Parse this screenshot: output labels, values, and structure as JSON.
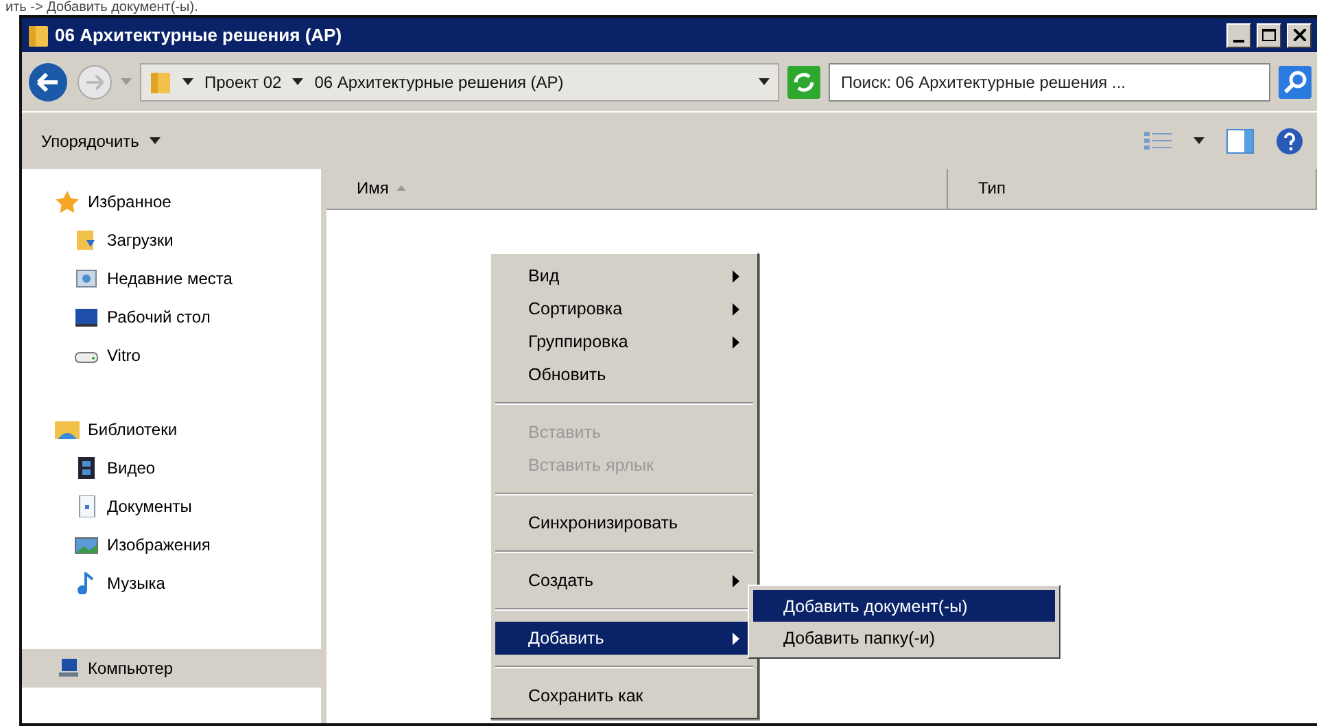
{
  "caption": "ить -> Добавить документ(-ы).",
  "window": {
    "title": "06 Архитектурные решения (АР)"
  },
  "address_bar": {
    "crumbs": [
      "Проект 02",
      "06 Архитектурные решения (АР)"
    ]
  },
  "search": {
    "placeholder": "Поиск: 06 Архитектурные решения ..."
  },
  "toolbar": {
    "organize": "Упорядочить"
  },
  "sidebar": {
    "groups": [
      {
        "label": "Избранное",
        "selected": false,
        "children": [
          {
            "label": "Загрузки",
            "selected": false
          },
          {
            "label": "Недавние места",
            "selected": false
          },
          {
            "label": "Рабочий стол",
            "selected": false
          },
          {
            "label": "Vitro",
            "selected": false
          }
        ]
      },
      {
        "label": "Библиотеки",
        "selected": false,
        "children": [
          {
            "label": "Видео",
            "selected": false
          },
          {
            "label": "Документы",
            "selected": false
          },
          {
            "label": "Изображения",
            "selected": false
          },
          {
            "label": "Музыка",
            "selected": false
          }
        ]
      },
      {
        "label": "Компьютер",
        "selected": true
      }
    ]
  },
  "table": {
    "columns": [
      {
        "label": "Имя",
        "sorted": true
      },
      {
        "label": "Тип",
        "sorted": false
      }
    ]
  },
  "context_menu": {
    "items": [
      {
        "kind": "item",
        "label": "Вид",
        "submenu": true,
        "disabled": false,
        "selected": false
      },
      {
        "kind": "item",
        "label": "Сортировка",
        "submenu": true,
        "disabled": false,
        "selected": false
      },
      {
        "kind": "item",
        "label": "Группировка",
        "submenu": true,
        "disabled": false,
        "selected": false
      },
      {
        "kind": "item",
        "label": "Обновить",
        "submenu": false,
        "disabled": false,
        "selected": false
      },
      {
        "kind": "separator"
      },
      {
        "kind": "item",
        "label": "Вставить",
        "submenu": false,
        "disabled": true,
        "selected": false
      },
      {
        "kind": "item",
        "label": "Вставить ярлык",
        "submenu": false,
        "disabled": true,
        "selected": false
      },
      {
        "kind": "separator"
      },
      {
        "kind": "item",
        "label": "Синхронизировать",
        "submenu": false,
        "disabled": false,
        "selected": false
      },
      {
        "kind": "separator"
      },
      {
        "kind": "item",
        "label": "Создать",
        "submenu": true,
        "disabled": false,
        "selected": false
      },
      {
        "kind": "separator"
      },
      {
        "kind": "item",
        "label": "Добавить",
        "submenu": true,
        "disabled": false,
        "selected": true
      },
      {
        "kind": "separator"
      },
      {
        "kind": "item",
        "label": "Сохранить как",
        "submenu": false,
        "disabled": false,
        "selected": false
      }
    ]
  },
  "submenu": {
    "items": [
      {
        "label": "Добавить документ(-ы)",
        "selected": true
      },
      {
        "label": "Добавить папку(-и)",
        "selected": false
      }
    ]
  }
}
